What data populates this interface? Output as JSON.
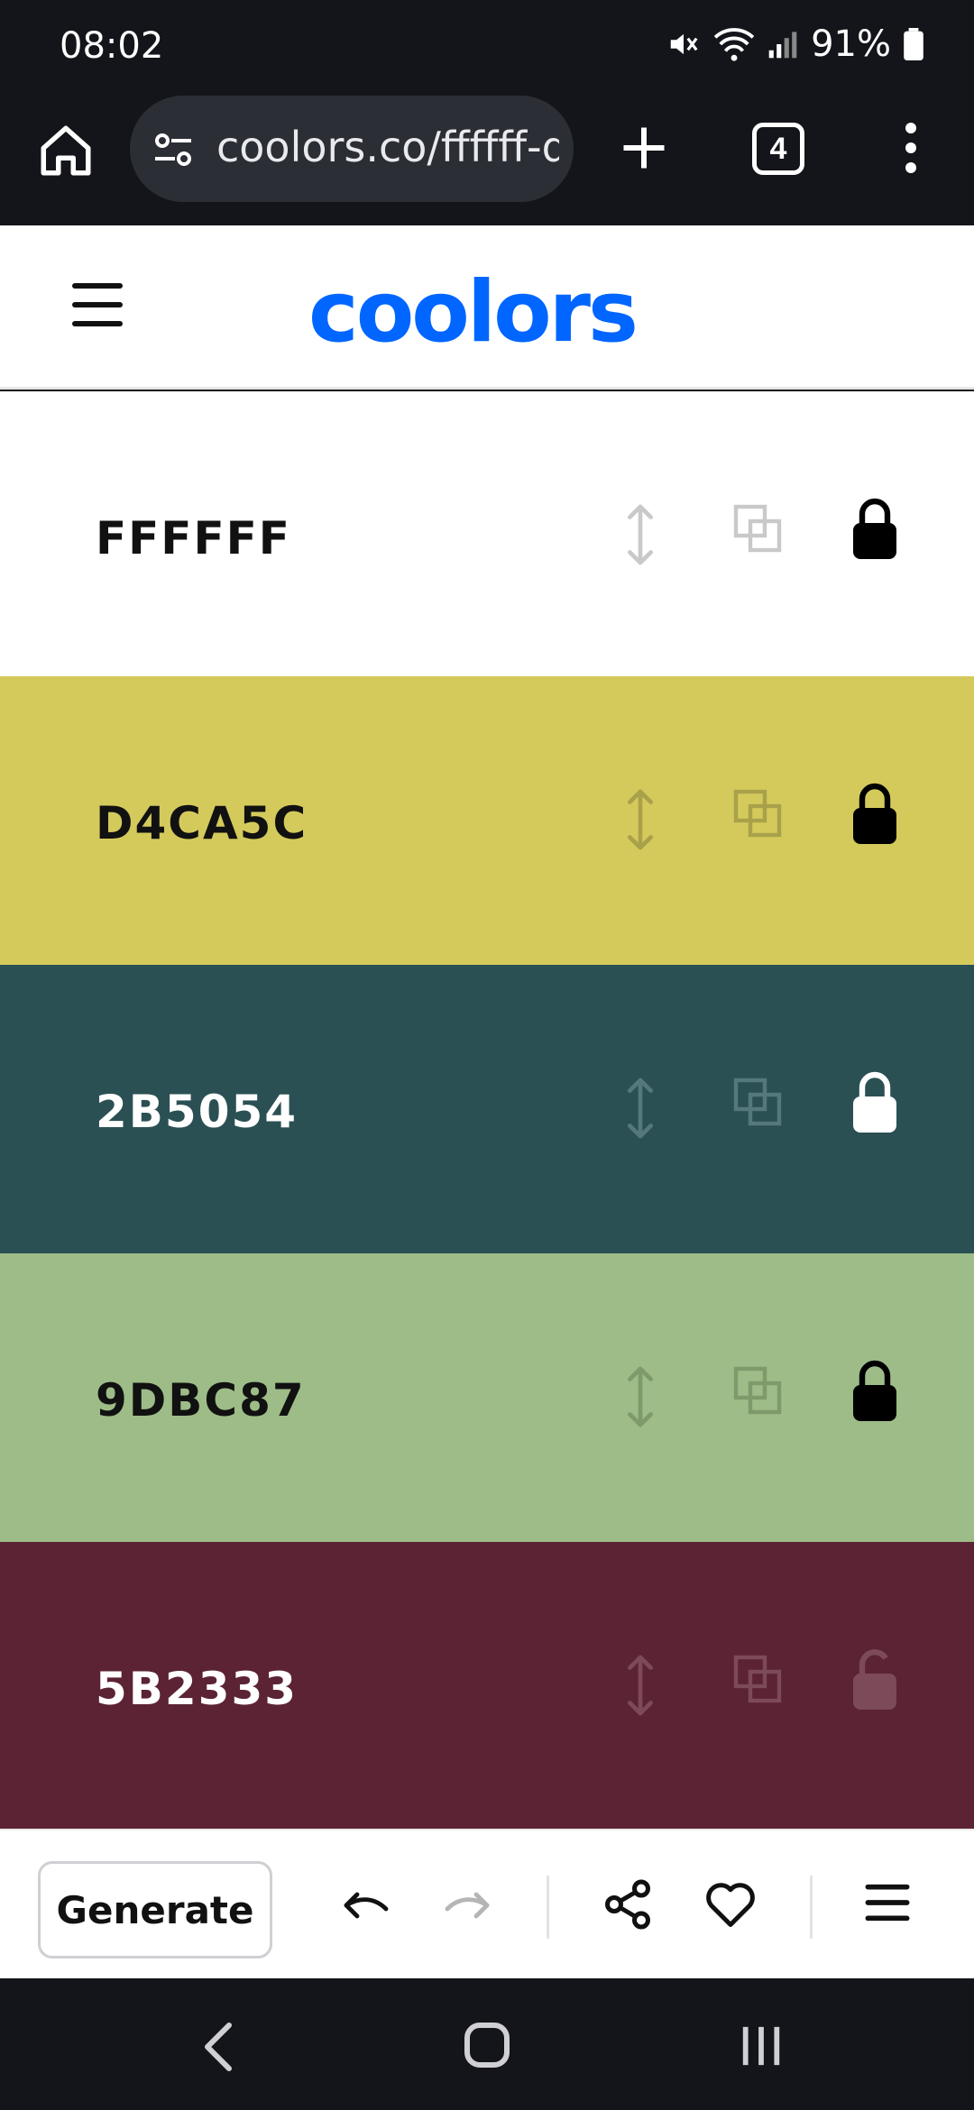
{
  "status_bar": {
    "time": "08:02",
    "battery": "91%"
  },
  "browser": {
    "url": "coolors.co/ffffff-d",
    "tab_count": "4"
  },
  "app": {
    "logo": "coolors"
  },
  "swatches": [
    {
      "hex": "FFFFFF",
      "bg": "#FFFFFF",
      "text_color": "#111111",
      "icon_color": "#c9c9c9",
      "lock_color": "#000000",
      "locked": true
    },
    {
      "hex": "D4CA5C",
      "bg": "#D4CA5C",
      "text_color": "#111111",
      "icon_color": "#a9a14a",
      "lock_color": "#000000",
      "locked": true
    },
    {
      "hex": "2B5054",
      "bg": "#2B5054",
      "text_color": "#FFFFFF",
      "icon_color": "#55787b",
      "lock_color": "#FFFFFF",
      "locked": true
    },
    {
      "hex": "9DBC87",
      "bg": "#9DBC87",
      "text_color": "#111111",
      "icon_color": "#7e9a6b",
      "lock_color": "#000000",
      "locked": true
    },
    {
      "hex": "5B2333",
      "bg": "#5B2333",
      "text_color": "#FFFFFF",
      "icon_color": "#7c4a58",
      "lock_color": "#7c4a58",
      "locked": false
    }
  ],
  "toolbar": {
    "generate_label": "Generate"
  }
}
